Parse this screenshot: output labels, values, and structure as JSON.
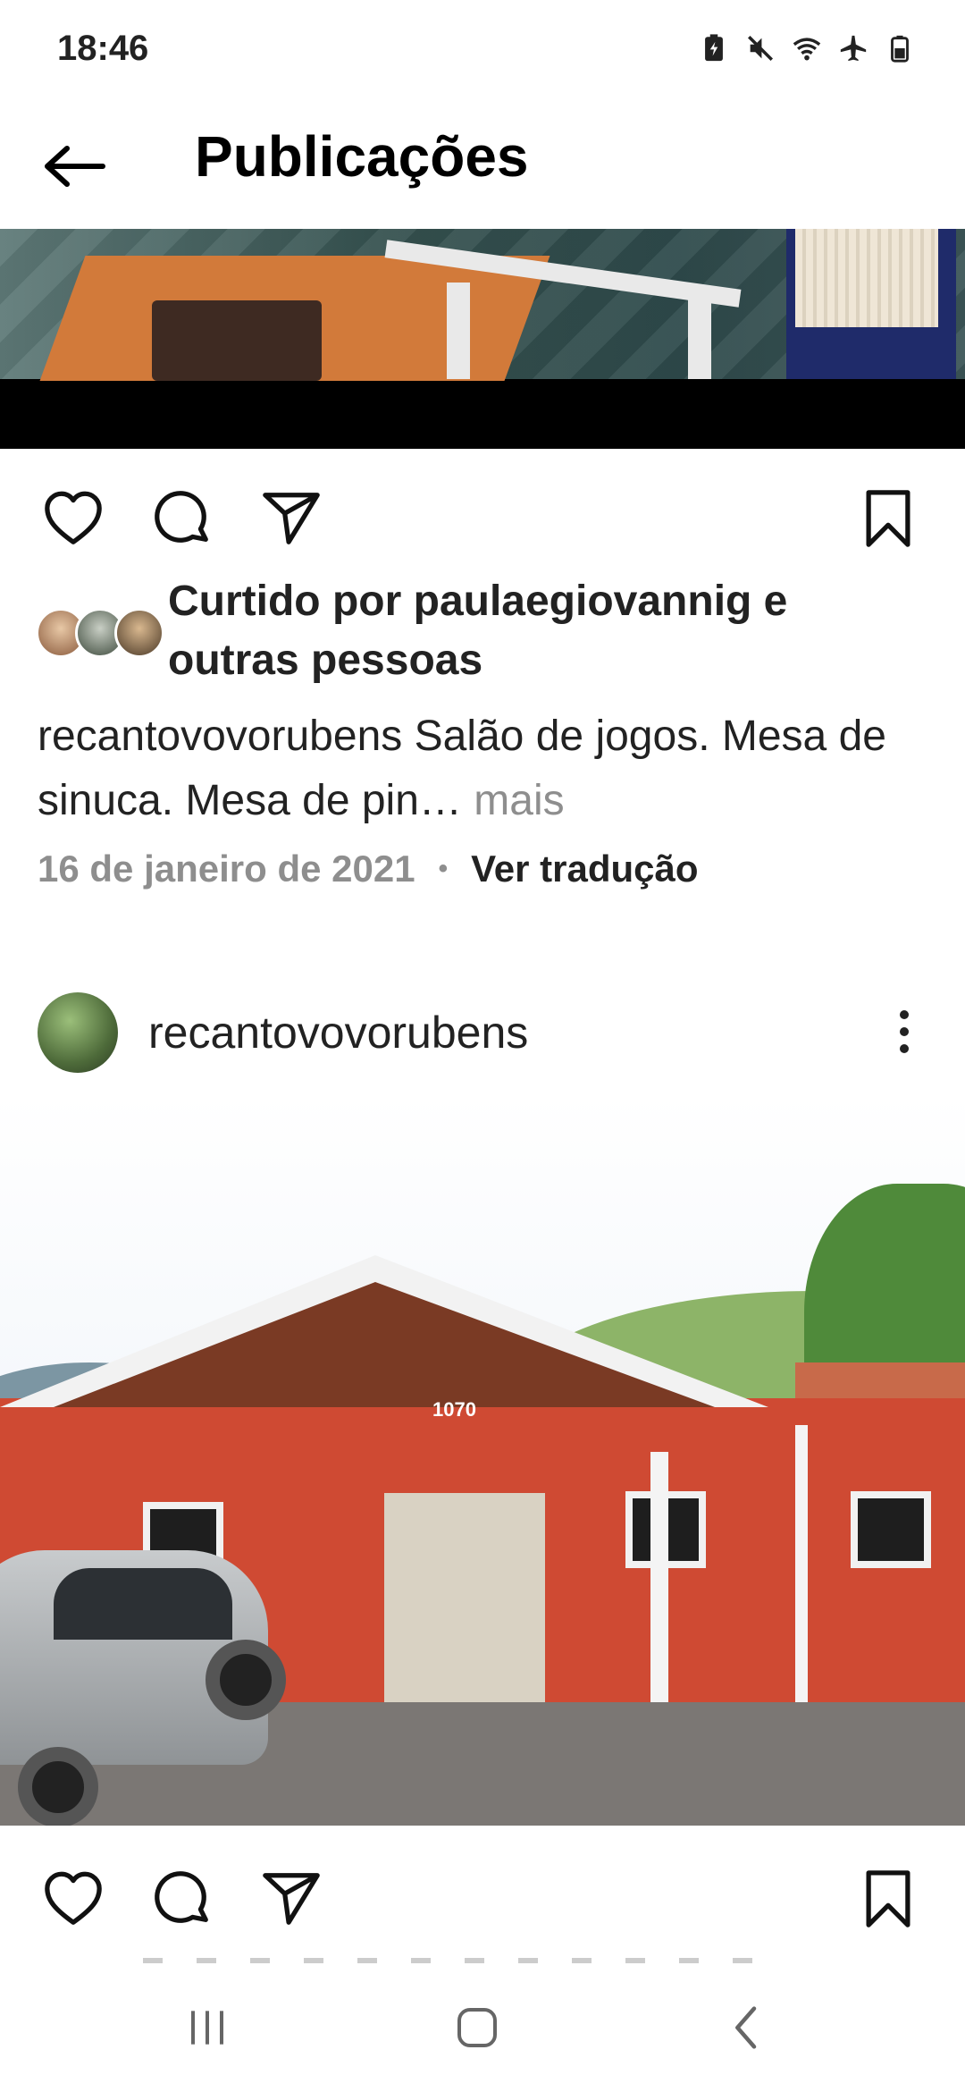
{
  "status_bar": {
    "time": "18:46",
    "icons": [
      "battery-saver-icon",
      "mute-icon",
      "wifi-icon",
      "airplane-icon",
      "battery-icon"
    ]
  },
  "header": {
    "back_icon": "back-arrow-icon",
    "title": "Publicações"
  },
  "post1": {
    "image_alt": "",
    "actions": [
      "like-icon",
      "comment-icon",
      "share-icon",
      "save-icon"
    ],
    "liked_by_text": "Curtido por paulaegiovannig e outras pessoas",
    "caption_user": "recantovovorubens",
    "caption_text": "Salão de jogos. Mesa de sinuca. Mesa de pin…",
    "caption_more": "mais",
    "date": "16 de janeiro de 2021",
    "separator": "•",
    "translate_label": "Ver tradução"
  },
  "post2": {
    "username": "recantovovorubens",
    "more_icon": "more-vertical-icon",
    "house_number": "1070",
    "actions": [
      "like-icon",
      "comment-icon",
      "share-icon",
      "save-icon"
    ]
  },
  "navbar": {
    "buttons": [
      "recents-icon",
      "home-icon",
      "back-icon"
    ]
  },
  "colors": {
    "text": "#222222",
    "muted": "#8e8e8e",
    "background": "#ffffff"
  }
}
